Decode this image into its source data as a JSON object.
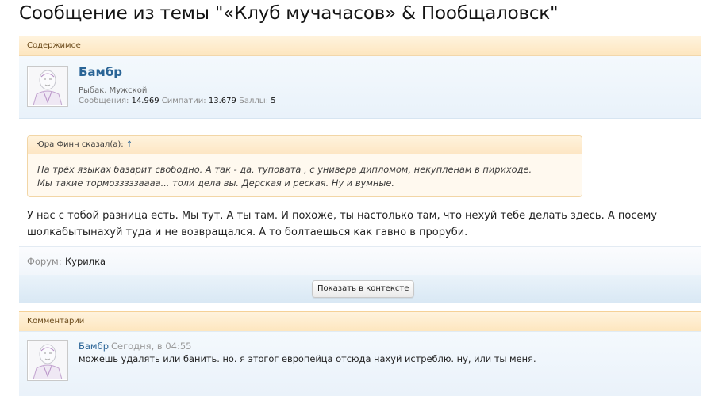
{
  "page": {
    "title": "Сообщение из темы \"«Клуб мучачасов» & Пообщаловск\""
  },
  "content_section": {
    "header": "Содержимое"
  },
  "author": {
    "name": "Бамбр",
    "title": "Рыбак, Мужской",
    "stats": {
      "messages_label": "Сообщения:",
      "messages_value": "14.969",
      "likes_label": "Симпатии:",
      "likes_value": "13.679",
      "points_label": "Баллы:",
      "points_value": "5"
    }
  },
  "quote": {
    "header": "Юра Финн сказал(а):",
    "arrow": "↑",
    "lines": [
      "На трёх языках базарит свободно. А так - да, туповата , с универа дипломом, некупленам в пириходе.",
      "Мы такие тормозззззаааа... толи дела вы. Дерская и реская. Ну и вумные."
    ]
  },
  "message": {
    "lines": [
      "У нас с тобой разница есть. Мы тут. А ты там. И похоже, ты настолько там, что нехуй тебе делать здесь. А посему",
      "шолкабытынахуй туда и не возвращался. А то болтаешься как гавно в проруби."
    ]
  },
  "forum": {
    "label": "Форум:",
    "value": "Курилка"
  },
  "context_button": "Показать в контексте",
  "comments_section": {
    "header": "Комментарии"
  },
  "comment": {
    "author": "Бамбр",
    "time": "Сегодня, в 04:55",
    "text": "можешь удалять или банить. но. я этогог европейца отсюда нахуй истреблю. ну, или ты меня."
  }
}
